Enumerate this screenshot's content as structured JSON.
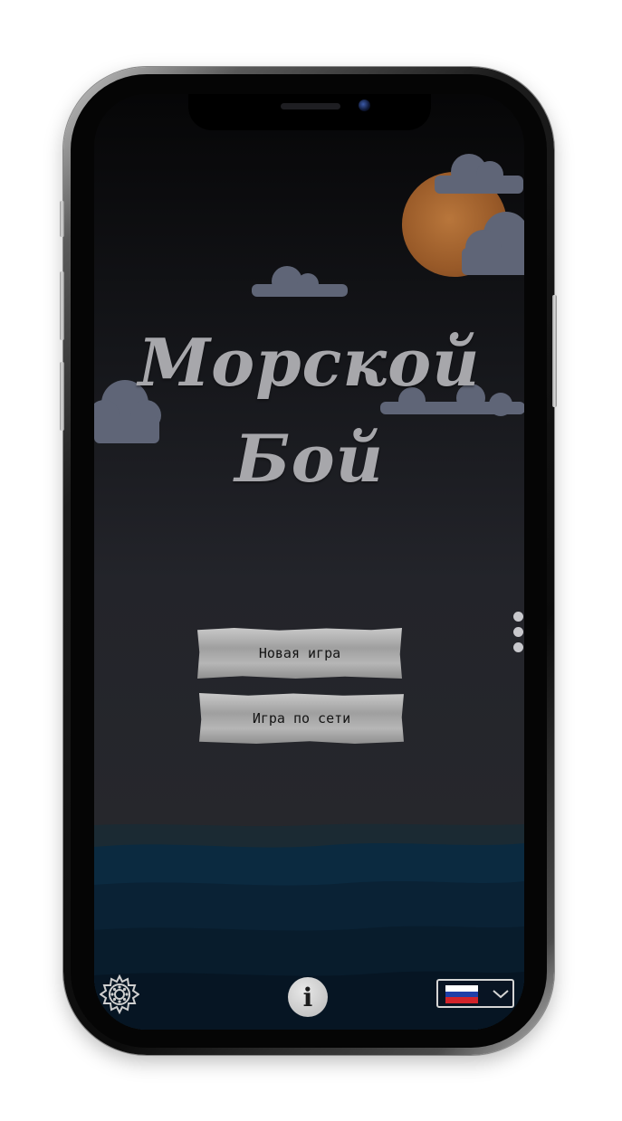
{
  "app": {
    "title_line1": "Морской",
    "title_line2": "Бой"
  },
  "menu": {
    "new_game": "Новая игра",
    "online_game": "Игра по сети"
  },
  "side_menu": {
    "icon": "vertical-dots-icon"
  },
  "footer": {
    "settings_icon": "gear-icon",
    "info_label": "i",
    "language": {
      "flag": "russia-flag-icon",
      "dropdown_icon": "chevron-down-icon",
      "flag_colors": [
        "#ffffff",
        "#1f3fa8",
        "#d2232a"
      ]
    }
  },
  "colors": {
    "moon": "#a4602a",
    "sea": "#0c2033",
    "paper": "#b0b0b0"
  }
}
